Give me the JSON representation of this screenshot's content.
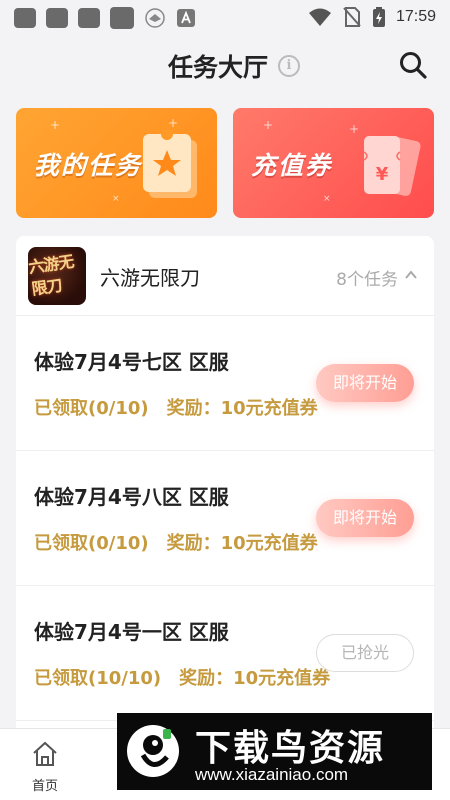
{
  "status_bar": {
    "time": "17:59",
    "icons": [
      "app-icon",
      "app-icon",
      "app-icon",
      "app-icon",
      "bird-icon",
      "font-icon",
      "wifi-icon",
      "no-sim-icon",
      "battery-charging-icon"
    ]
  },
  "header": {
    "title": "任务大厅",
    "icons": [
      "info-icon",
      "search-icon"
    ]
  },
  "banners": {
    "my_tasks": "我的任务",
    "coupons": "充值券",
    "colors": {
      "my_tasks": "#ff9a26",
      "coupons": "#ff5a55"
    }
  },
  "game": {
    "logo_text": "六游无限刀",
    "name": "六游无限刀",
    "task_count": "8个任务"
  },
  "tasks": [
    {
      "title": "体验7月4号七区 区服",
      "claimed": "已领取(0/10)",
      "reward": "奖励：10元充值券",
      "button": "即将开始"
    },
    {
      "title": "体验7月4号八区 区服",
      "claimed": "已领取(0/10)",
      "reward": "奖励：10元充值券",
      "button": "即将开始"
    },
    {
      "title": "体验7月4号一区 区服",
      "claimed": "已领取(10/10)",
      "reward": "奖励：10元充值券",
      "button": "已抢光"
    }
  ],
  "bottom_nav": {
    "home": "首页"
  },
  "watermark": {
    "text": "下载鸟资源",
    "url": "www.xiazainiao.com"
  },
  "colors": {
    "accent_gold": "#c69a3e",
    "button_soon": "#ff9e94"
  }
}
